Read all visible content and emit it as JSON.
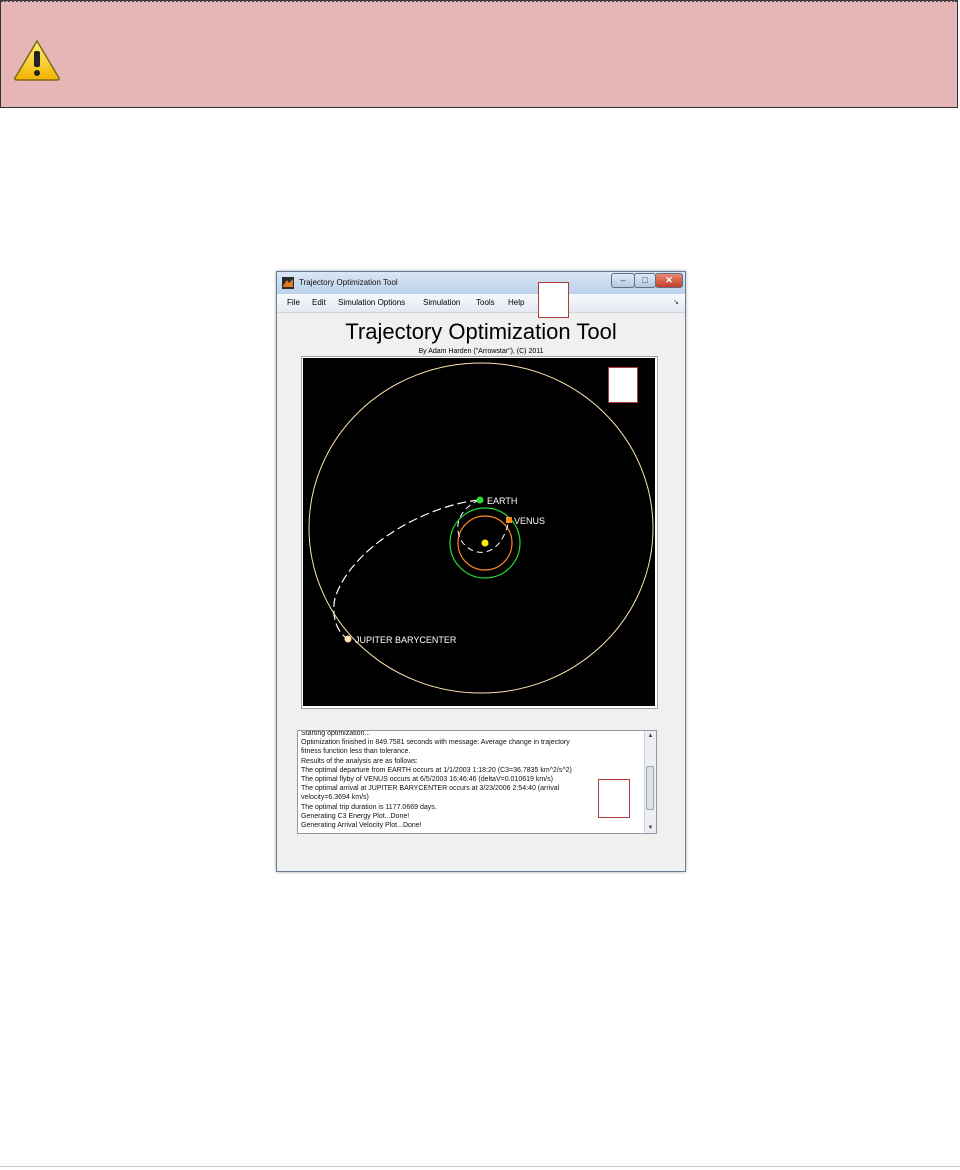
{
  "window": {
    "title": "Trajectory Optimization Tool",
    "controls": {
      "minimize": "–",
      "maximize": "□",
      "close": "✕"
    }
  },
  "menu": {
    "items": [
      {
        "label": "File"
      },
      {
        "label": "Edit"
      },
      {
        "label": "Simulation Options"
      },
      {
        "label": "Simulation"
      },
      {
        "label": "Tools"
      },
      {
        "label": "Help"
      }
    ],
    "corner_glyph": "↘"
  },
  "header": {
    "title": "Trajectory Optimization Tool",
    "subtitle": "By Adam Harden (\"Arrowstar\"), (C) 2011"
  },
  "plot": {
    "labels": {
      "earth": "EARTH",
      "venus": "VENUS",
      "jupiter": "JUPITER BARYCENTER"
    },
    "colors": {
      "background": "#000000",
      "sun": "#ffee00",
      "earth": "#22dd33",
      "venus": "#ff8822",
      "jupiter": "#ffe4b0",
      "trajectory": "#ffffff"
    }
  },
  "console": {
    "lines": [
      "Starting optimization...",
      "Optimization finished in 849.7581 seconds with message: Average change in trajectory",
      "fitness function less than tolerance.",
      "Results of the analysis are as follows:",
      "The optimal departure from EARTH occurs at 1/1/2003 1:18:20 (C3=36.7835 km^2/s^2)",
      "The optimal flyby of VENUS occurs at 6/5/2003 16:46:46 (deltaV=0.010619 km/s)",
      "The optimal arrival at JUPITER BARYCENTER occurs at 3/23/2006 2:54:40 (arrival",
      "velocity=6.3694 km/s)",
      "The optimal trip duration is 1177.0669 days.",
      "Generating C3 Energy Plot...Done!",
      "Generating Arrival Velocity Plot...Done!"
    ],
    "scroll": {
      "up": "▲",
      "down": "▼"
    }
  },
  "banner": {
    "icon": "warning-icon",
    "color": "#e6b5b5"
  }
}
